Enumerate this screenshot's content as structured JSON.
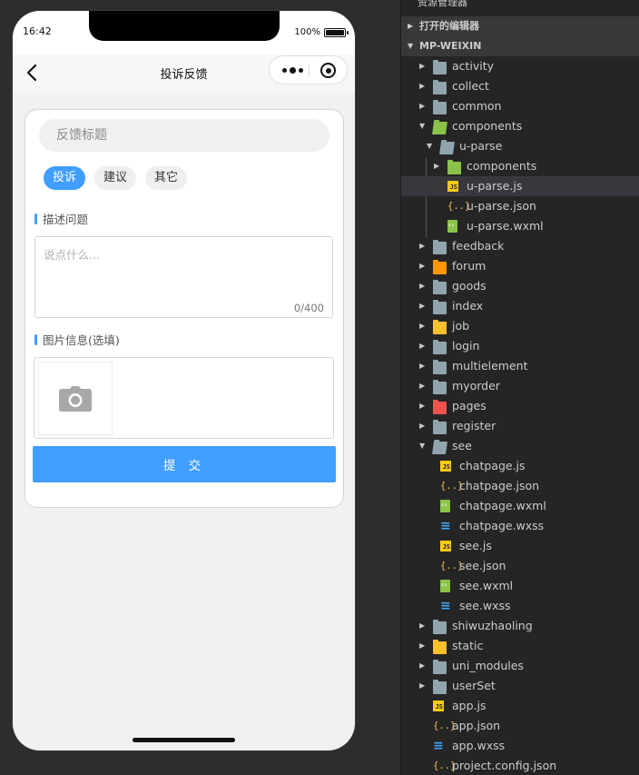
{
  "phone": {
    "status_time": "16:42",
    "battery_text": "100%",
    "nav_title": "投诉反馈"
  },
  "form": {
    "title_placeholder": "反馈标题",
    "tags": [
      "投诉",
      "建议",
      "其它"
    ],
    "active_tag": "投诉",
    "describe_label": "描述问题",
    "description_placeholder": "说点什么...",
    "char_count": "0/400",
    "image_label": "图片信息(选填)",
    "submit_label": "提 交"
  },
  "explorer": {
    "header_title": "资源管理器",
    "header_more": "···",
    "open_editors_label": "打开的编辑器",
    "project_label": "MP-WEIXIN",
    "tree": [
      {
        "label": "activity",
        "type": "folder",
        "depth": 0,
        "expanded": false,
        "color": "#90a4ae"
      },
      {
        "label": "collect",
        "type": "folder",
        "depth": 0,
        "expanded": false,
        "color": "#90a4ae"
      },
      {
        "label": "common",
        "type": "folder",
        "depth": 0,
        "expanded": false,
        "color": "#90a4ae"
      },
      {
        "label": "components",
        "type": "folder",
        "depth": 0,
        "expanded": true,
        "color": "#8bc34a"
      },
      {
        "label": "u-parse",
        "type": "folder",
        "depth": 1,
        "expanded": true,
        "color": "#90a4ae"
      },
      {
        "label": "components",
        "type": "folder",
        "depth": 2,
        "expanded": false,
        "color": "#8bc34a"
      },
      {
        "label": "u-parse.js",
        "type": "js",
        "depth": 2,
        "selected": true
      },
      {
        "label": "u-parse.json",
        "type": "json",
        "depth": 2
      },
      {
        "label": "u-parse.wxml",
        "type": "wxml",
        "depth": 2
      },
      {
        "label": "feedback",
        "type": "folder",
        "depth": 0,
        "expanded": false,
        "color": "#90a4ae"
      },
      {
        "label": "forum",
        "type": "folder",
        "depth": 0,
        "expanded": false,
        "color": "#ff9800"
      },
      {
        "label": "goods",
        "type": "folder",
        "depth": 0,
        "expanded": false,
        "color": "#90a4ae"
      },
      {
        "label": "index",
        "type": "folder",
        "depth": 0,
        "expanded": false,
        "color": "#90a4ae"
      },
      {
        "label": "job",
        "type": "folder",
        "depth": 0,
        "expanded": false,
        "color": "#fbc02d"
      },
      {
        "label": "login",
        "type": "folder",
        "depth": 0,
        "expanded": false,
        "color": "#90a4ae"
      },
      {
        "label": "multielement",
        "type": "folder",
        "depth": 0,
        "expanded": false,
        "color": "#90a4ae"
      },
      {
        "label": "myorder",
        "type": "folder",
        "depth": 0,
        "expanded": false,
        "color": "#90a4ae"
      },
      {
        "label": "pages",
        "type": "folder",
        "depth": 0,
        "expanded": false,
        "color": "#ef5350"
      },
      {
        "label": "register",
        "type": "folder",
        "depth": 0,
        "expanded": false,
        "color": "#90a4ae"
      },
      {
        "label": "see",
        "type": "folder",
        "depth": 0,
        "expanded": true,
        "color": "#90a4ae"
      },
      {
        "label": "chatpage.js",
        "type": "js",
        "depth": 1
      },
      {
        "label": "chatpage.json",
        "type": "json",
        "depth": 1
      },
      {
        "label": "chatpage.wxml",
        "type": "wxml",
        "depth": 1
      },
      {
        "label": "chatpage.wxss",
        "type": "wxss",
        "depth": 1
      },
      {
        "label": "see.js",
        "type": "js",
        "depth": 1
      },
      {
        "label": "see.json",
        "type": "json",
        "depth": 1
      },
      {
        "label": "see.wxml",
        "type": "wxml",
        "depth": 1
      },
      {
        "label": "see.wxss",
        "type": "wxss",
        "depth": 1
      },
      {
        "label": "shiwuzhaoling",
        "type": "folder",
        "depth": 0,
        "expanded": false,
        "color": "#90a4ae"
      },
      {
        "label": "static",
        "type": "folder",
        "depth": 0,
        "expanded": false,
        "color": "#fbc02d"
      },
      {
        "label": "uni_modules",
        "type": "folder",
        "depth": 0,
        "expanded": false,
        "color": "#90a4ae"
      },
      {
        "label": "userSet",
        "type": "folder",
        "depth": 0,
        "expanded": false,
        "color": "#90a4ae"
      },
      {
        "label": "app.js",
        "type": "js",
        "depth": 0
      },
      {
        "label": "app.json",
        "type": "json",
        "depth": 0
      },
      {
        "label": "app.wxss",
        "type": "wxss",
        "depth": 0
      },
      {
        "label": "project.config.json",
        "type": "json",
        "depth": 0
      }
    ]
  }
}
